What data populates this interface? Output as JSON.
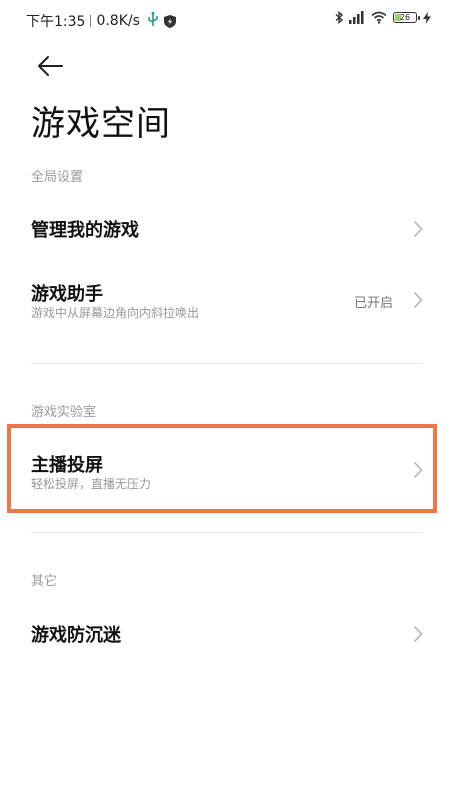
{
  "status_bar": {
    "time": "下午1:35",
    "network_speed": "0.8K/s",
    "usb_icon": "usb-icon",
    "shield_icon": "shield-icon",
    "bluetooth_icon": "bluetooth-icon",
    "signal_icon": "signal-icon",
    "wifi_icon": "wifi-icon",
    "battery_level": "26",
    "charging_icon": "charging-bolt-icon"
  },
  "header": {
    "back_icon": "back-arrow-icon",
    "title": "游戏空间"
  },
  "sections": {
    "global": {
      "label": "全局设置",
      "items": {
        "manage": {
          "title": "管理我的游戏"
        },
        "assistant": {
          "title": "游戏助手",
          "subtitle": "游戏中从屏幕边角向内斜拉唤出",
          "value": "已开启"
        }
      }
    },
    "lab": {
      "label": "游戏实验室",
      "items": {
        "cast": {
          "title": "主播投屏",
          "subtitle": "轻松投屏，直播无压力"
        }
      }
    },
    "other": {
      "label": "其它",
      "items": {
        "anti_addiction": {
          "title": "游戏防沉迷"
        }
      }
    }
  },
  "colors": {
    "highlight": "#f0764a",
    "battery_fill": "#9ccf6c",
    "usb_green": "#21a08a"
  }
}
